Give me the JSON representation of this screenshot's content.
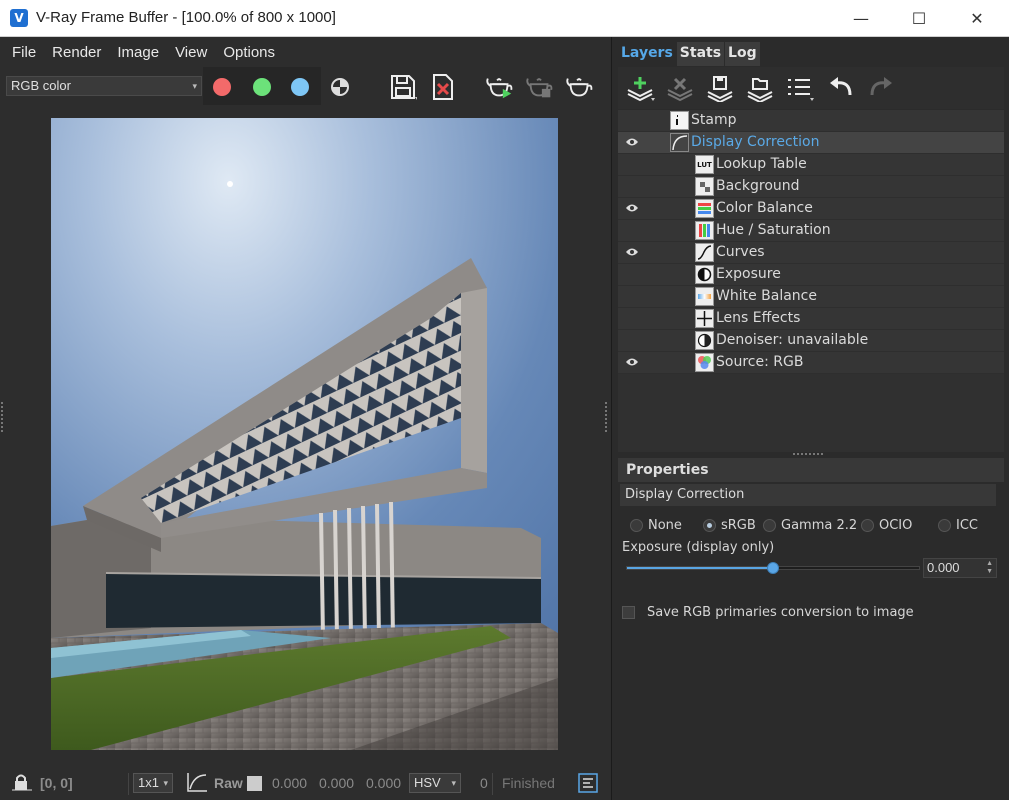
{
  "window": {
    "title": "V-Ray Frame Buffer - [100.0% of 800 x 1000]",
    "app_icon_glyph": "V",
    "minimize_glyph": "—",
    "maximize_glyph": "☐",
    "close_glyph": "✕"
  },
  "menu": {
    "items": [
      "File",
      "Render",
      "Image",
      "View",
      "Options"
    ]
  },
  "toolbar": {
    "channel_select": "RGB color",
    "dropdown_arrow": "▾"
  },
  "statusbar": {
    "coords": "[0, 0]",
    "zoom_select": "1x1",
    "raw_label": "Raw",
    "value_r": "0.000",
    "value_g": "0.000",
    "value_b": "0.000",
    "colorspace_select": "HSV",
    "count": "0",
    "status": "Finished"
  },
  "right_panel": {
    "tabs": [
      "Layers",
      "Stats",
      "Log"
    ],
    "layers": [
      {
        "name": "Stamp",
        "visible": false,
        "icon": "stamp-icon",
        "indent": 1
      },
      {
        "name": "Display Correction",
        "visible": true,
        "icon": "display-correction-icon",
        "indent": 1,
        "selected": true
      },
      {
        "name": "Lookup Table",
        "visible": false,
        "icon": "lut-icon",
        "indent": 2,
        "icon_text": "LUT"
      },
      {
        "name": "Background",
        "visible": false,
        "icon": "background-icon",
        "indent": 2
      },
      {
        "name": "Color Balance",
        "visible": true,
        "icon": "color-balance-icon",
        "indent": 2
      },
      {
        "name": "Hue / Saturation",
        "visible": false,
        "icon": "hue-saturation-icon",
        "indent": 2
      },
      {
        "name": "Curves",
        "visible": true,
        "icon": "curves-icon",
        "indent": 2
      },
      {
        "name": "Exposure",
        "visible": false,
        "icon": "exposure-icon",
        "indent": 2
      },
      {
        "name": "White Balance",
        "visible": false,
        "icon": "white-balance-icon",
        "indent": 2
      },
      {
        "name": "Lens Effects",
        "visible": false,
        "icon": "lens-effects-icon",
        "indent": 2
      },
      {
        "name": "Denoiser: unavailable",
        "visible": false,
        "icon": "denoiser-icon",
        "indent": 2
      },
      {
        "name": "Source: RGB",
        "visible": true,
        "icon": "source-rgb-icon",
        "indent": 2
      }
    ],
    "properties": {
      "header": "Properties",
      "section": "Display Correction",
      "radio_options": [
        "None",
        "sRGB",
        "Gamma 2.2",
        "OCIO",
        "ICC"
      ],
      "radio_selected": "sRGB",
      "exposure_label": "Exposure (display only)",
      "exposure_value": "0.000",
      "exposure_slider_fraction": 0.5,
      "checkbox_label": "Save RGB primaries conversion to image",
      "checkbox_checked": false
    }
  },
  "colors": {
    "accent": "#56a8e8",
    "red_channel": "#f36a6a",
    "green_channel": "#6ce27a",
    "blue_channel": "#7ec6f5"
  }
}
